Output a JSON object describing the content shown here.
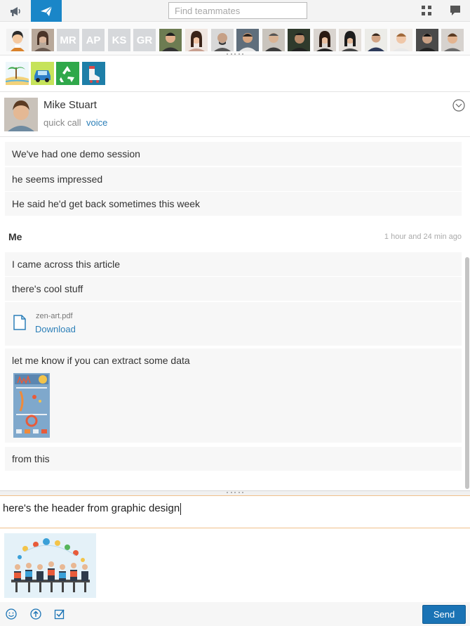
{
  "toolbar": {
    "search_placeholder": "Find teammates"
  },
  "team": {
    "initials": [
      "MR",
      "AP",
      "KS",
      "GR"
    ]
  },
  "bots": [
    "beach-bot-icon",
    "car-bot-icon",
    "recycle-bot-icon",
    "skate-bot-icon"
  ],
  "contact": {
    "name": "Mike Stuart",
    "quick_call": "quick call",
    "voice": "voice"
  },
  "messages": {
    "incoming": [
      "We've had one demo session",
      "he seems impressed",
      "He said he'd get back sometimes this week"
    ],
    "sender": "Me",
    "timestamp": "1 hour and 24 min ago",
    "outgoing": [
      "I came across this article",
      "there's cool stuff",
      "let me know if you can extract some data",
      "from this"
    ],
    "file": {
      "name": "zen-art.pdf",
      "action": "Download"
    }
  },
  "compose": {
    "text": "here's the header from graphic design"
  },
  "actions": {
    "send": "Send"
  },
  "colors": {
    "accent": "#1a86c8",
    "link": "#2c7fb8",
    "send_button": "#1a73b5",
    "compose_border": "#f0c08a"
  }
}
